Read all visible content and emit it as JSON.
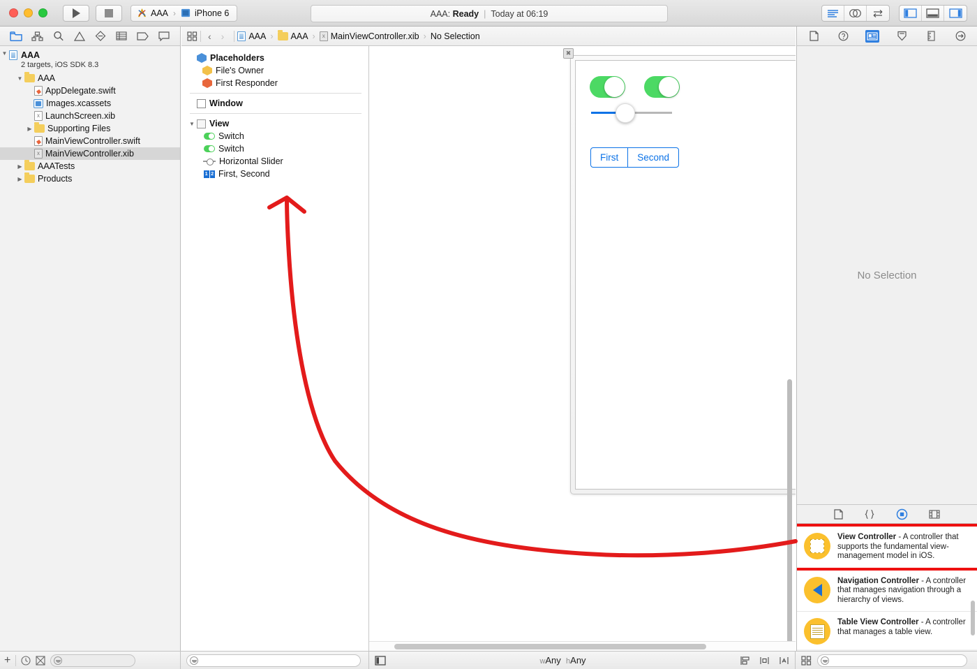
{
  "window": {
    "traffic_lights": [
      "close",
      "minimize",
      "zoom"
    ],
    "run_button": "run-icon",
    "stop_button": "stop-icon",
    "scheme": {
      "project": "AAA",
      "destination": "iPhone 6"
    },
    "status": {
      "scheme": "AAA:",
      "state": "Ready",
      "separator": "|",
      "time": "Today at 06:19"
    },
    "editor_modes": [
      "standard-editor-icon",
      "assistant-editor-icon",
      "version-editor-icon"
    ],
    "view_toggles": [
      "toggle-navigator-icon",
      "toggle-debug-area-icon",
      "toggle-utilities-icon"
    ]
  },
  "navigator": {
    "tabs": [
      "project-navigator-icon",
      "symbol-navigator-icon",
      "find-navigator-icon",
      "issue-navigator-icon",
      "test-navigator-icon",
      "debug-navigator-icon",
      "breakpoint-navigator-icon",
      "report-navigator-icon"
    ],
    "project": {
      "name": "AAA",
      "subtitle": "2 targets, iOS SDK 8.3"
    },
    "items": [
      {
        "label": "AAA",
        "icon": "folder-icon",
        "depth": 1,
        "expanded": true
      },
      {
        "label": "AppDelegate.swift",
        "icon": "swift-file-icon",
        "depth": 2
      },
      {
        "label": "Images.xcassets",
        "icon": "assets-icon",
        "depth": 2
      },
      {
        "label": "LaunchScreen.xib",
        "icon": "xib-file-icon",
        "depth": 2
      },
      {
        "label": "Supporting Files",
        "icon": "folder-icon",
        "depth": 2,
        "expanded": false
      },
      {
        "label": "MainViewController.swift",
        "icon": "swift-file-icon",
        "depth": 2
      },
      {
        "label": "MainViewController.xib",
        "icon": "xib-file-icon",
        "depth": 2,
        "selected": true
      },
      {
        "label": "AAATests",
        "icon": "folder-icon",
        "depth": 1,
        "expanded": false
      },
      {
        "label": "Products",
        "icon": "folder-icon",
        "depth": 1,
        "expanded": false
      }
    ],
    "bottom": {
      "add_label": "+",
      "recent_icon": "clock-icon",
      "source_ctrl_icon": "source-control-icon",
      "filter_placeholder": ""
    }
  },
  "breadcrumb": {
    "related_icon": "related-items-icon",
    "back": "‹",
    "forward": "›",
    "path": [
      "AAA",
      "AAA",
      "MainViewController.xib",
      "No Selection"
    ]
  },
  "outline": {
    "groups": [
      {
        "title": "Placeholders",
        "icon": "cube-blue-icon",
        "bold": true,
        "children": [
          {
            "label": "File's Owner",
            "icon": "cube-yellow-icon"
          },
          {
            "label": "First Responder",
            "icon": "cube-orange-icon"
          }
        ]
      },
      {
        "title": "Window",
        "icon": "square-icon",
        "bold": true,
        "children": []
      },
      {
        "title": "View",
        "icon": "square-gray-icon",
        "bold": true,
        "expanded": true,
        "children": [
          {
            "label": "Switch",
            "icon": "switch-icon"
          },
          {
            "label": "Switch",
            "icon": "switch-icon"
          },
          {
            "label": "Horizontal Slider",
            "icon": "slider-icon"
          },
          {
            "label": "First, Second",
            "icon": "segmented-control-icon"
          }
        ]
      }
    ],
    "bottom": {
      "filter_placeholder": ""
    }
  },
  "canvas": {
    "close_badge": "✖",
    "switches": [
      {
        "name": "switch-left",
        "on": true
      },
      {
        "name": "switch-right",
        "on": true
      }
    ],
    "slider": {
      "name": "horizontal-slider",
      "value_pct": 42
    },
    "segmented": {
      "segments": [
        "First",
        "Second"
      ],
      "selected": null
    },
    "bottom": {
      "toggle_document_outline": "toggle-outline-icon",
      "size_class_w": "wAny",
      "size_class_h": "hAny",
      "size_class_prefix_w": "w",
      "size_class_prefix_h": "h",
      "tools": [
        "align-icon",
        "pin-icon",
        "resolve-issues-icon"
      ]
    }
  },
  "inspector": {
    "tabs": [
      "file-inspector-icon",
      "quick-help-icon",
      "identity-inspector-icon",
      "attributes-inspector-icon",
      "size-inspector-icon",
      "connections-inspector-icon"
    ],
    "active_tab_index": 2,
    "empty_message": "No Selection",
    "library_tabs": [
      "file-template-library-icon",
      "code-snippet-library-icon",
      "object-library-icon",
      "media-library-icon"
    ],
    "active_library_index": 2,
    "library_items": [
      {
        "title": "View Controller",
        "desc": " - A controller that supports the fundamental view-management model in iOS.",
        "icon": "view-controller-icon",
        "highlighted": true
      },
      {
        "title": "Navigation Controller",
        "desc": " - A controller that manages navigation through a hierarchy of views.",
        "icon": "navigation-controller-icon",
        "highlighted": false
      },
      {
        "title": "Table View Controller",
        "desc": " - A controller that manages a table view.",
        "icon": "table-view-controller-icon",
        "highlighted": false
      }
    ],
    "bottom": {
      "layout_icon": "library-layout-icon",
      "filter_placeholder": ""
    }
  },
  "annotation": {
    "color": "#e31b1b",
    "shape": "curved-arrow-pointing-to-view-controller"
  }
}
